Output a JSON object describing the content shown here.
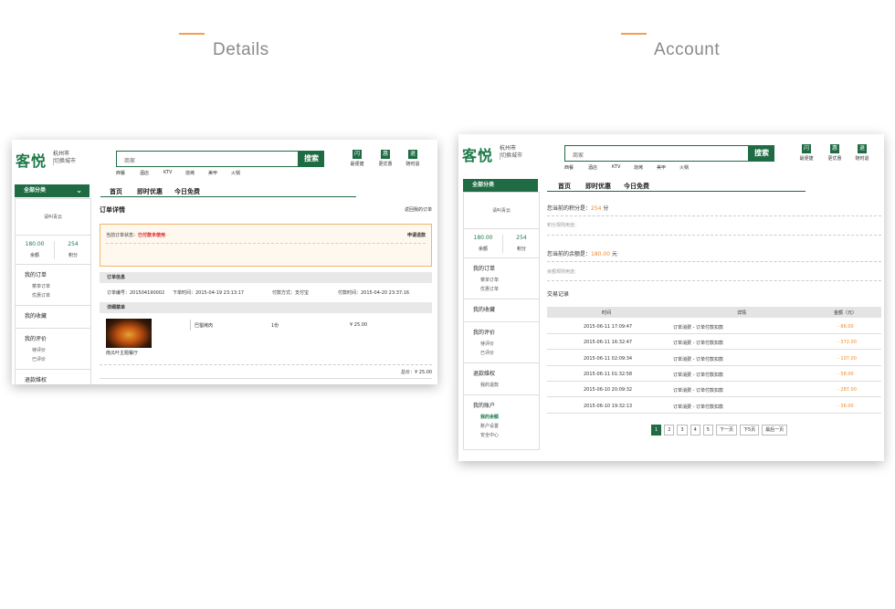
{
  "sections": {
    "left_title": "Details",
    "right_title": "Account"
  },
  "header": {
    "logo": "客悦",
    "city": "杭州市",
    "switch_city": "切换城市",
    "search_placeholder": "商家",
    "search_button": "搜索",
    "hot_words": [
      "西餐",
      "酒店",
      "KTV",
      "烧烤",
      "美甲",
      "火锅"
    ],
    "quick_links": [
      {
        "icon_char": "闪",
        "label": "最便捷"
      },
      {
        "icon_char": "惠",
        "label": "更优惠"
      },
      {
        "icon_char": "退",
        "label": "随时退"
      }
    ]
  },
  "nav": {
    "category_button": "全部分类",
    "links": [
      "首页",
      "即时优惠",
      "今日免费"
    ]
  },
  "sidebar": {
    "user": "请叫青云",
    "balance_value": "180.00",
    "balance_label": "余额",
    "points_value": "254",
    "points_label": "积分",
    "left_groups": [
      {
        "title": "我的订单",
        "items": [
          "菜单订单",
          "优惠订单"
        ]
      },
      {
        "title": "我的收藏",
        "items": []
      },
      {
        "title": "我的评价",
        "items": [
          "待评价",
          "已评价"
        ]
      },
      {
        "title": "退款维权",
        "items": []
      }
    ],
    "right_groups": [
      {
        "title": "我的订单",
        "items": [
          "菜单订单",
          "优惠订单"
        ]
      },
      {
        "title": "我的收藏",
        "items": []
      },
      {
        "title": "我的评价",
        "items": [
          "待评价",
          "已评价"
        ]
      },
      {
        "title": "退款维权",
        "items": [
          "我的退款"
        ]
      },
      {
        "title": "我的账户",
        "items": [
          "我的余额",
          "账户设置",
          "安全中心"
        ]
      }
    ]
  },
  "order": {
    "title": "订单详情",
    "back": "返回我的订单",
    "status_label": "当前订单状态：",
    "status_value": "已付款未使用",
    "refund": "申请退款",
    "info_title": "订单信息",
    "order_no": "订单编号：201504190002",
    "order_time": "下单时间：2015-04-19 23:13:17",
    "pay_method": "付款方式：支付宝",
    "pay_time": "付款时间：2015-04-20 23:37:16",
    "menu_title": "详细菜单",
    "shop": "南瓜叶主题餐厅",
    "dish": "巴蜀烤肉",
    "qty": "1份",
    "price": "¥ 25.00",
    "total": "总价：¥ 25.00"
  },
  "account": {
    "points_prefix": "您当前的积分是：",
    "points_value": "254",
    "points_unit": "分",
    "points_usage": "积分规则用途：",
    "balance_prefix": "您当前的余额是：",
    "balance_value": "180.00",
    "balance_unit": "元",
    "balance_usage": "余额规则用途：",
    "tx_title": "交易记录",
    "columns": [
      "时间",
      "详情",
      "金额（元）"
    ],
    "rows": [
      {
        "time": "2015-06-11 17:09:47",
        "detail": "订单消费 - 订单付款扣款",
        "amount": "- 86.00"
      },
      {
        "time": "2015-06-11 16:32:47",
        "detail": "订单消费 - 订单付款扣款",
        "amount": "- 372.00"
      },
      {
        "time": "2015-06-11 02:09:34",
        "detail": "订单消费 - 订单付款扣款",
        "amount": "- 107.00"
      },
      {
        "time": "2015-06-11 01:32:58",
        "detail": "订单消费 - 订单付款扣款",
        "amount": "- 58.00"
      },
      {
        "time": "2015-06-10 20:09:32",
        "detail": "订单消费 - 订单付款扣款",
        "amount": "- 287.00"
      },
      {
        "time": "2015-06-10 19:32:13",
        "detail": "订单消费 - 订单付款扣款",
        "amount": "- 36.00"
      }
    ],
    "pager": [
      "1",
      "2",
      "3",
      "4",
      "5",
      "下一页",
      "下5页",
      "最后一页"
    ]
  },
  "colors": {
    "brand": "#1f6b44",
    "accent": "#f08a2a",
    "alert": "#e02020"
  }
}
